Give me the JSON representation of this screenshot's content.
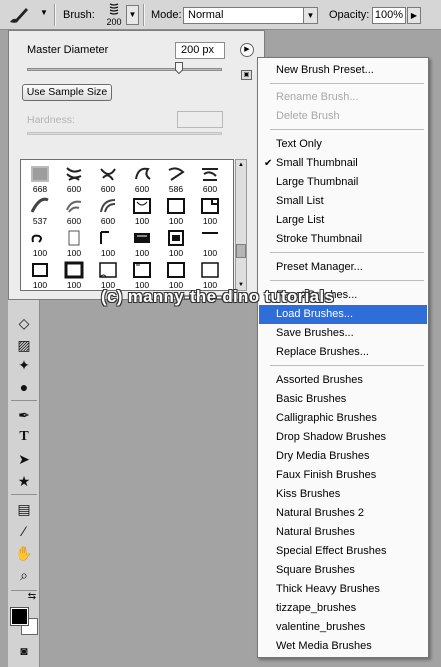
{
  "options_bar": {
    "brush_label": "Brush:",
    "brush_size": "200",
    "mode_label": "Mode:",
    "mode_value": "Normal",
    "opacity_label": "Opacity:",
    "opacity_value": "100%"
  },
  "brush_panel": {
    "master_diameter_label": "Master Diameter",
    "master_diameter_value": "200 px",
    "slider_fraction": 0.78,
    "use_sample_size_label": "Use Sample Size",
    "hardness_label": "Hardness:",
    "brushes": [
      {
        "size": "668"
      },
      {
        "size": "600"
      },
      {
        "size": "600"
      },
      {
        "size": "600"
      },
      {
        "size": "586"
      },
      {
        "size": "600"
      },
      {
        "size": "537"
      },
      {
        "size": "600"
      },
      {
        "size": "600"
      },
      {
        "size": "100"
      },
      {
        "size": "100"
      },
      {
        "size": "100"
      },
      {
        "size": "100"
      },
      {
        "size": "100"
      },
      {
        "size": "100"
      },
      {
        "size": "100"
      },
      {
        "size": "100"
      },
      {
        "size": "100"
      },
      {
        "size": "100"
      },
      {
        "size": "100"
      },
      {
        "size": "100"
      },
      {
        "size": "100"
      },
      {
        "size": "100"
      },
      {
        "size": "100"
      }
    ]
  },
  "context_menu": {
    "new_brush_preset": "New Brush Preset...",
    "rename_brush": "Rename Brush...",
    "delete_brush": "Delete Brush",
    "text_only": "Text Only",
    "small_thumbnail": "Small Thumbnail",
    "large_thumbnail": "Large Thumbnail",
    "small_list": "Small List",
    "large_list": "Large List",
    "stroke_thumbnail": "Stroke Thumbnail",
    "preset_manager": "Preset Manager...",
    "reset_brushes": "Reset Brushes...",
    "load_brushes": "Load Brushes...",
    "save_brushes": "Save Brushes...",
    "replace_brushes": "Replace Brushes...",
    "brush_sets": [
      "Assorted Brushes",
      "Basic Brushes",
      "Calligraphic Brushes",
      "Drop Shadow Brushes",
      "Dry Media Brushes",
      "Faux Finish Brushes",
      "Kiss Brushes",
      "Natural Brushes 2",
      "Natural Brushes",
      "Special Effect Brushes",
      "Square Brushes",
      "Thick Heavy Brushes",
      "tizzape_brushes",
      "valentine_brushes",
      "Wet Media Brushes"
    ]
  },
  "watermark": "(c) manny-the-dino tutorials",
  "colors": {
    "highlight": "#2f6dd8",
    "foreground_swatch": "#000000",
    "background_swatch": "#ffffff",
    "canvas_bg": "#a3a3a3"
  }
}
